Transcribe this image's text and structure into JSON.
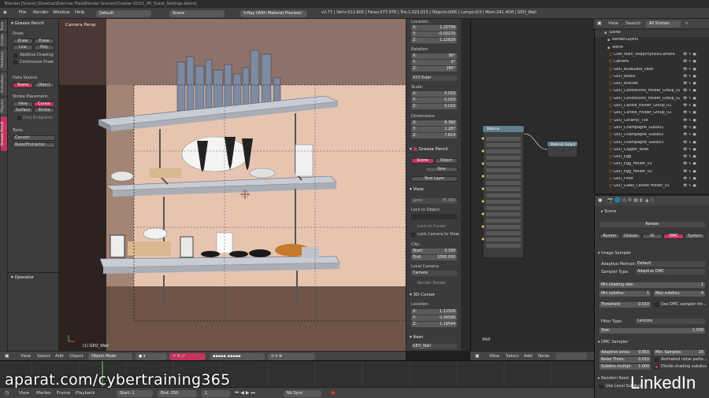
{
  "titlebar": "Blender [Scene] [Desktop\\Exercise Files\\Blender Scenes\\Chapter 01\\01_05_Quick_Settings.blend]",
  "menu": [
    "File",
    "Render",
    "Window",
    "Help"
  ],
  "layout": "Default",
  "scene": "Scene",
  "engine": "V-Ray (With Material Preview)",
  "stats": "v2.77 | Verts:512,605 | Faces:577,976 | Tris:1,023,015 | Objects:0/66 | Lamps:0/3 | Mem:241.45M | GEO_Wall",
  "left_tabs": [
    "Tools",
    "Create",
    "Relations",
    "Animation",
    "Physics",
    "Grease Pencil"
  ],
  "toolshelf": {
    "title": "Grease Pencil",
    "draw_label": "Draw:",
    "draw": "Draw",
    "erase": "Erase",
    "line": "Line",
    "poly": "Poly",
    "additive": "Additive Drawing",
    "continuous": "Continuous Draw",
    "data_source": "Data Source:",
    "src_scene": "Scene",
    "src_object": "Object",
    "stroke_place": "Stroke Placement:",
    "view": "View",
    "cursor": "Cursor",
    "surface": "Surface",
    "stroke": "Stroke",
    "only_endpoints": "Only Endpoints",
    "tools_label": "Tools:",
    "convert": "Convert",
    "ruler": "Ruler/Protractor",
    "operator": "Operator"
  },
  "viewport": {
    "label": "Camera Persp",
    "object": "(1) GEO_Wall"
  },
  "vp_header": [
    "View",
    "Select",
    "Add",
    "Object",
    "Object Mode"
  ],
  "npanel": {
    "location": "Location:",
    "loc": [
      [
        "X:",
        "1.20799"
      ],
      [
        "Y:",
        "-0.03270"
      ],
      [
        "Z:",
        "1.22829"
      ]
    ],
    "rotation": "Rotation:",
    "rot": [
      [
        "X:",
        "90°"
      ],
      [
        "Y:",
        "0°"
      ],
      [
        "Z:",
        "180°"
      ]
    ],
    "rot_mode": "XYZ Euler",
    "scale": "Scale:",
    "scl": [
      [
        "X:",
        "0.010"
      ],
      [
        "Y:",
        "0.010"
      ],
      [
        "Z:",
        "0.010"
      ]
    ],
    "dimensions": "Dimensions:",
    "dim": [
      [
        "X:",
        "6.360"
      ],
      [
        "Y:",
        "2.287"
      ],
      [
        "Z:",
        "7.614"
      ]
    ],
    "gp_title": "Grease Pencil",
    "gp_scene": "Scene",
    "gp_object": "Object",
    "new": "New",
    "new_layer": "New Layer",
    "view_title": "View",
    "lens": "Lens:",
    "lens_val": "35.000",
    "lock_obj": "Lock to Object:",
    "lock_cursor": "Lock to Cursor",
    "lock_cam": "Lock Camera to View",
    "clip": "Clip:",
    "start": "Start:",
    "start_val": "0.100",
    "end": "End:",
    "end_val": "1000.000",
    "local_cam": "Local Camera:",
    "camera": "Camera",
    "render_border": "Render Border",
    "cursor_title": "3D Cursor",
    "cur": [
      [
        "X:",
        "1.11509"
      ],
      [
        "Y:",
        "0.34590"
      ],
      [
        "Z:",
        "1.19544"
      ]
    ],
    "item_title": "Item",
    "item_name": "GEO_Wall"
  },
  "node_editor": {
    "node1": "Material",
    "node2": "Material Output",
    "label": "Wall",
    "header": [
      "View",
      "Select",
      "Add",
      "Node"
    ]
  },
  "outliner": {
    "header": [
      "View",
      "Search",
      "All Scenes"
    ],
    "items": [
      "Scene",
      "RenderLayers",
      "World",
      "CAM_Main_VRayPhysicalCamera",
      "Camera",
      "GEO_BlueGlass_vase",
      "GEO_Books",
      "GEO_Bracket",
      "GEO_CandleStick_Holder_Group_01",
      "GEO_CandleStick_Holder_Group_02",
      "GEO_Candle_Holder_Group_01",
      "GEO_Candle_Holder_Group_02",
      "GEO_Ceramic_Tile",
      "GEO_Champagne_Glass01",
      "GEO_Champagne_Glass02",
      "GEO_Champagne_Glass03",
      "GEO_Copper_Bowl",
      "GEO_Egg",
      "GEO_Egg_Holder_01",
      "GEO_Egg_Holder_02",
      "GEO_Floor",
      "GEO_Glass_Candle Holder_02"
    ]
  },
  "props": {
    "scene": "Scene",
    "render": "Render",
    "tabs": [
      "Render",
      "Globals",
      "GI",
      "DMC",
      "System"
    ],
    "image_sampler": "Image Sampler",
    "adaptive_method": "Adaptive Method:",
    "adaptive_val": "Default",
    "sampler_type": "Sampler Type:",
    "sampler_val": "Adaptive DMC",
    "min_rate": "Min shading rate:",
    "min_rate_val": "1",
    "min_subdivs": "Min subdivs:",
    "min_subdivs_val": "1",
    "max_subdivs": "Max subdivs:",
    "max_subdivs_val": "4",
    "threshold": "Threshold:",
    "threshold_val": "0.010",
    "use_dmc": "Use DMC sampler thr...",
    "filter_type": "Filter Type:",
    "filter_val": "Lanczos",
    "size": "Size:",
    "size_val": "1.500",
    "dmc_sampler": "DMC Sampler",
    "adaptive_amount": "Adaptive amou:",
    "adaptive_amount_val": "0.850",
    "min_samples": "Min. Samples:",
    "min_samples_val": "16",
    "noise_thresh": "Noise Thres:",
    "noise_thresh_val": "0.010",
    "animated_noise": "Animated noise patte...",
    "subdivs_mult": "Subdivs multipl:",
    "subdivs_mult_val": "1.000",
    "divide_shading": "Divide shading subdivs",
    "random_seed": "Random Seed",
    "use_local": "Use Local Subdivs"
  },
  "timeline": {
    "header": [
      "View",
      "Marker",
      "Frame",
      "Playback"
    ],
    "start": "Start:",
    "start_val": "1",
    "end": "End:",
    "end_val": "250",
    "current": "1",
    "sync": "No Sync"
  },
  "watermark": "aparat.com/cybertraining365",
  "linkedin": "LinkedIn",
  "colors": {
    "accent": "#c4345f",
    "panel": "#3d3d3d",
    "field": "#5a5a5a"
  }
}
